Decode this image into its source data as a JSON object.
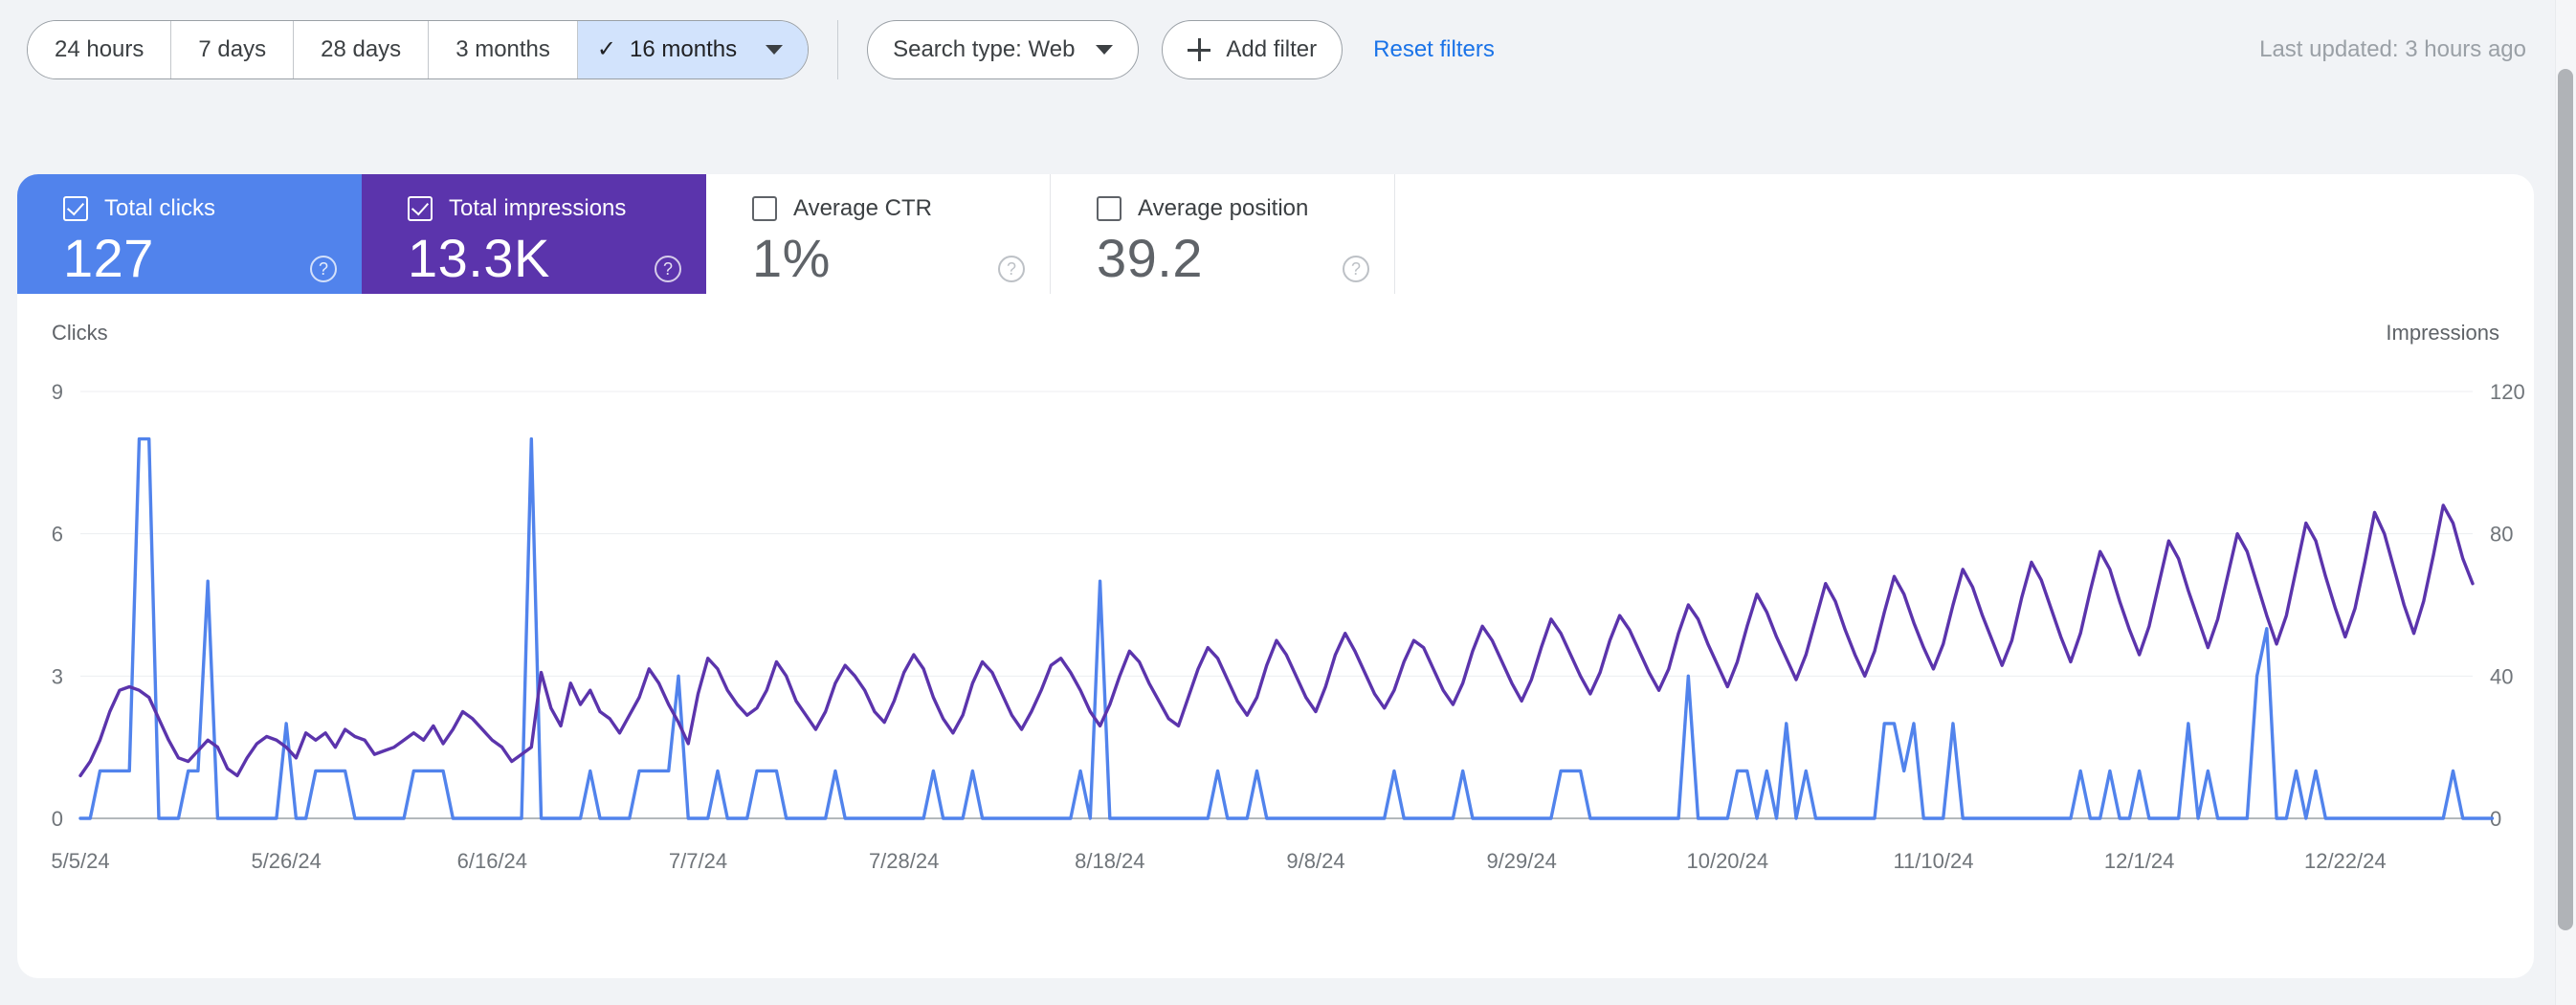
{
  "toolbar": {
    "date_ranges": [
      {
        "label": "24 hours",
        "active": false
      },
      {
        "label": "7 days",
        "active": false
      },
      {
        "label": "28 days",
        "active": false
      },
      {
        "label": "3 months",
        "active": false
      },
      {
        "label": "16 months",
        "active": true
      }
    ],
    "search_type": "Search type: Web",
    "add_filter": "Add filter",
    "reset_filters": "Reset filters",
    "last_updated": "Last updated: 3 hours ago"
  },
  "metrics": [
    {
      "label": "Total clicks",
      "value": "127",
      "checked": true,
      "state": "sel-clicks",
      "help": "?"
    },
    {
      "label": "Total impressions",
      "value": "13.3K",
      "checked": true,
      "state": "sel-impr",
      "help": "?"
    },
    {
      "label": "Average CTR",
      "value": "1%",
      "checked": false,
      "state": "",
      "help": "?"
    },
    {
      "label": "Average position",
      "value": "39.2",
      "checked": false,
      "state": "",
      "help": "?"
    }
  ],
  "colors": {
    "clicks": "#5183ec",
    "impressions": "#5b34ac",
    "link": "#1a73e8",
    "active_pill_bg": "#d2e3fc",
    "page_bg": "#f1f3f6"
  },
  "chart_data": {
    "type": "line",
    "title": "",
    "xlabel": "",
    "ylabel": "Clicks",
    "y2label": "Impressions",
    "grid": true,
    "legend": "none",
    "ylim": [
      0,
      9
    ],
    "y2lim": [
      0,
      120
    ],
    "yticks": [
      0,
      3,
      6,
      9
    ],
    "y2ticks": [
      0,
      40,
      80,
      120
    ],
    "xtick_labels": [
      "5/5/24",
      "5/26/24",
      "6/16/24",
      "7/7/24",
      "7/28/24",
      "8/18/24",
      "9/8/24",
      "9/29/24",
      "10/20/24",
      "11/10/24",
      "12/1/24",
      "12/22/24"
    ],
    "xtick_indices": [
      0,
      21,
      42,
      63,
      84,
      105,
      126,
      147,
      168,
      189,
      210,
      231
    ],
    "n_points": 245,
    "series": [
      {
        "name": "Clicks",
        "axis": "left",
        "color": "#5183ec",
        "values": [
          0,
          0,
          1,
          1,
          1,
          1,
          8,
          8,
          0,
          0,
          0,
          1,
          1,
          5,
          0,
          0,
          0,
          0,
          0,
          0,
          0,
          2,
          0,
          0,
          1,
          1,
          1,
          1,
          0,
          0,
          0,
          0,
          0,
          0,
          1,
          1,
          1,
          1,
          0,
          0,
          0,
          0,
          0,
          0,
          0,
          0,
          8,
          0,
          0,
          0,
          0,
          0,
          1,
          0,
          0,
          0,
          0,
          1,
          1,
          1,
          1,
          3,
          0,
          0,
          0,
          1,
          0,
          0,
          0,
          1,
          1,
          1,
          0,
          0,
          0,
          0,
          0,
          1,
          0,
          0,
          0,
          0,
          0,
          0,
          0,
          0,
          0,
          1,
          0,
          0,
          0,
          1,
          0,
          0,
          0,
          0,
          0,
          0,
          0,
          0,
          0,
          0,
          1,
          0,
          5,
          0,
          0,
          0,
          0,
          0,
          0,
          0,
          0,
          0,
          0,
          0,
          1,
          0,
          0,
          0,
          1,
          0,
          0,
          0,
          0,
          0,
          0,
          0,
          0,
          0,
          0,
          0,
          0,
          0,
          1,
          0,
          0,
          0,
          0,
          0,
          0,
          1,
          0,
          0,
          0,
          0,
          0,
          0,
          0,
          0,
          0,
          1,
          1,
          1,
          0,
          0,
          0,
          0,
          0,
          0,
          0,
          0,
          0,
          0,
          3,
          0,
          0,
          0,
          0,
          1,
          1,
          0,
          1,
          0,
          2,
          0,
          1,
          0,
          0,
          0,
          0,
          0,
          0,
          0,
          2,
          2,
          1,
          2,
          0,
          0,
          0,
          2,
          0,
          0,
          0,
          0,
          0,
          0,
          0,
          0,
          0,
          0,
          0,
          0,
          1,
          0,
          0,
          1,
          0,
          0,
          1,
          0,
          0,
          0,
          0,
          2,
          0,
          1,
          0,
          0,
          0,
          0,
          3,
          4,
          0,
          0,
          1,
          0,
          1,
          0,
          0,
          0,
          0,
          0,
          0,
          0,
          0,
          0,
          0,
          0,
          0,
          0,
          1,
          0,
          0,
          0,
          0
        ]
      },
      {
        "name": "Impressions",
        "axis": "right",
        "color": "#5b34ac",
        "values": [
          12,
          16,
          22,
          30,
          36,
          37,
          36,
          34,
          28,
          22,
          17,
          16,
          19,
          22,
          20,
          14,
          12,
          17,
          21,
          23,
          22,
          20,
          17,
          24,
          22,
          24,
          20,
          25,
          23,
          22,
          18,
          19,
          20,
          22,
          24,
          22,
          26,
          21,
          25,
          30,
          28,
          25,
          22,
          20,
          16,
          18,
          20,
          41,
          31,
          26,
          38,
          32,
          36,
          30,
          28,
          24,
          29,
          34,
          42,
          38,
          32,
          27,
          21,
          35,
          45,
          42,
          36,
          32,
          29,
          31,
          36,
          44,
          40,
          33,
          29,
          25,
          30,
          38,
          43,
          40,
          36,
          30,
          27,
          33,
          41,
          46,
          42,
          34,
          28,
          24,
          29,
          38,
          44,
          41,
          35,
          29,
          25,
          30,
          36,
          43,
          45,
          41,
          36,
          30,
          26,
          32,
          40,
          47,
          44,
          38,
          33,
          28,
          26,
          34,
          42,
          48,
          45,
          39,
          33,
          29,
          34,
          43,
          50,
          46,
          40,
          34,
          30,
          37,
          46,
          52,
          47,
          41,
          35,
          31,
          36,
          44,
          50,
          48,
          42,
          36,
          32,
          38,
          47,
          54,
          50,
          44,
          38,
          33,
          39,
          48,
          56,
          52,
          46,
          40,
          35,
          41,
          50,
          57,
          53,
          47,
          41,
          36,
          42,
          52,
          60,
          56,
          49,
          43,
          37,
          44,
          54,
          63,
          58,
          51,
          45,
          39,
          46,
          56,
          66,
          61,
          53,
          46,
          40,
          47,
          58,
          68,
          63,
          55,
          48,
          42,
          49,
          60,
          70,
          65,
          57,
          50,
          43,
          50,
          62,
          72,
          67,
          59,
          51,
          44,
          52,
          64,
          75,
          70,
          61,
          53,
          46,
          54,
          66,
          78,
          73,
          64,
          56,
          48,
          56,
          68,
          80,
          75,
          66,
          57,
          49,
          57,
          70,
          83,
          78,
          68,
          59,
          51,
          59,
          72,
          86,
          80,
          70,
          60,
          52,
          61,
          74,
          88,
          83,
          73,
          66
        ]
      }
    ]
  }
}
